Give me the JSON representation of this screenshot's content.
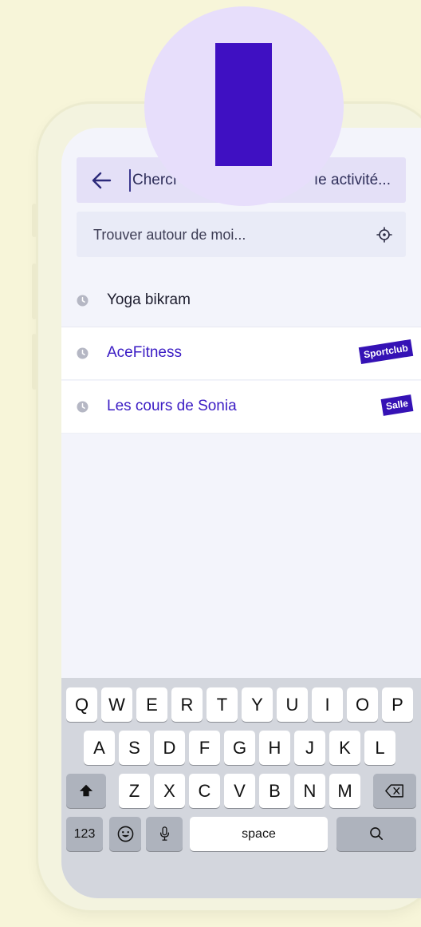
{
  "search": {
    "text_left": "Chercı",
    "text_right": "ıe activité..."
  },
  "location": {
    "placeholder": "Trouver autour de moi..."
  },
  "results": [
    {
      "label": "Yoga bikram",
      "badge": ""
    },
    {
      "label": "AceFitness",
      "badge": "Sportclub"
    },
    {
      "label": "Les cours de Sonia",
      "badge": "Salle"
    }
  ],
  "keyboard": {
    "row1": [
      "Q",
      "W",
      "E",
      "R",
      "T",
      "Y",
      "U",
      "I",
      "O",
      "P"
    ],
    "row2": [
      "A",
      "S",
      "D",
      "F",
      "G",
      "H",
      "J",
      "K",
      "L"
    ],
    "row3": [
      "Z",
      "X",
      "C",
      "V",
      "B",
      "N",
      "M"
    ],
    "numbers_key": "123",
    "space_key": "space"
  },
  "colors": {
    "accent": "#3f10c2",
    "background": "#f7f5d9",
    "decor_circle": "#e7defb"
  }
}
